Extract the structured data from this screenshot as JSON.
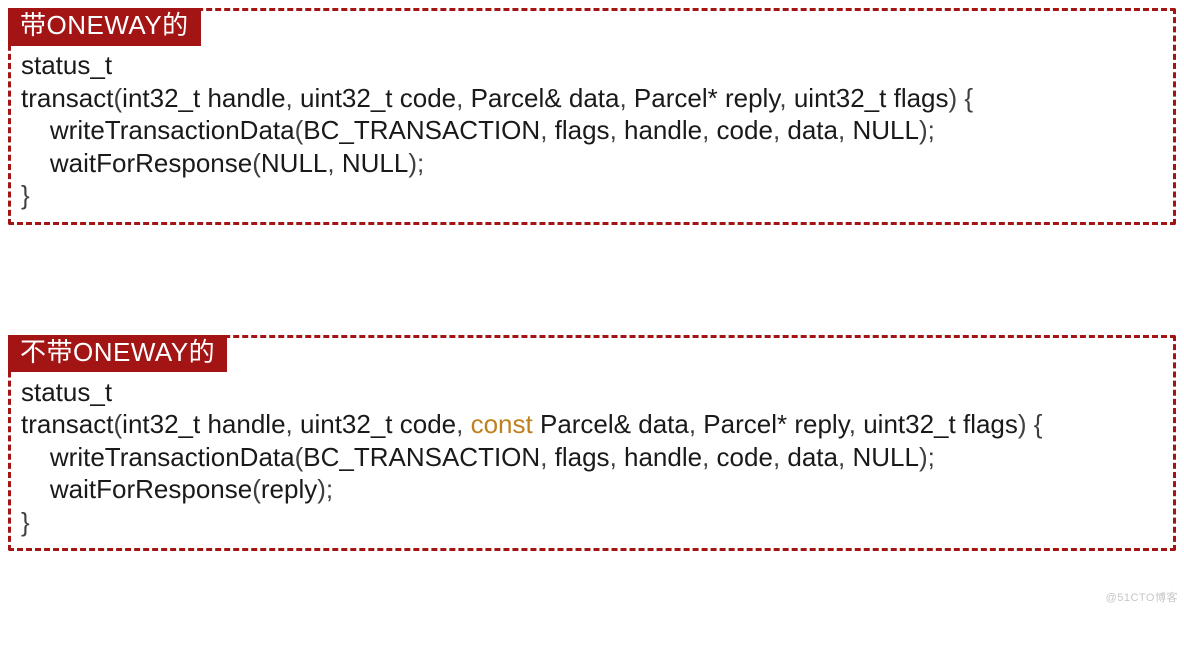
{
  "blocks": [
    {
      "title": "带ONEWAY的",
      "lines": [
        [
          {
            "t": "status_t",
            "c": "tok-id"
          }
        ],
        [
          {
            "t": "transact",
            "c": "tok-id"
          },
          {
            "t": "(",
            "c": "tok-punc"
          },
          {
            "t": "int32_t handle",
            "c": "tok-id"
          },
          {
            "t": ", ",
            "c": "tok-punc"
          },
          {
            "t": "uint32_t code",
            "c": "tok-id"
          },
          {
            "t": ", ",
            "c": "tok-punc"
          },
          {
            "t": "Parcel& data",
            "c": "tok-id"
          },
          {
            "t": ", ",
            "c": "tok-punc"
          },
          {
            "t": "Parcel* reply",
            "c": "tok-id"
          },
          {
            "t": ", ",
            "c": "tok-punc"
          },
          {
            "t": "uint32_t flags",
            "c": "tok-id"
          },
          {
            "t": ") {",
            "c": "tok-punc"
          }
        ],
        [
          {
            "t": "    writeTransactionData",
            "c": "tok-id"
          },
          {
            "t": "(",
            "c": "tok-punc"
          },
          {
            "t": "BC_TRANSACTION",
            "c": "tok-macro"
          },
          {
            "t": ", ",
            "c": "tok-punc"
          },
          {
            "t": "flags",
            "c": "tok-id"
          },
          {
            "t": ", ",
            "c": "tok-punc"
          },
          {
            "t": "handle",
            "c": "tok-id"
          },
          {
            "t": ", ",
            "c": "tok-punc"
          },
          {
            "t": "code",
            "c": "tok-id"
          },
          {
            "t": ", ",
            "c": "tok-punc"
          },
          {
            "t": "data",
            "c": "tok-id"
          },
          {
            "t": ", ",
            "c": "tok-punc"
          },
          {
            "t": "NULL",
            "c": "tok-id"
          },
          {
            "t": ");",
            "c": "tok-punc"
          }
        ],
        [
          {
            "t": "    waitForResponse",
            "c": "tok-id"
          },
          {
            "t": "(",
            "c": "tok-punc"
          },
          {
            "t": "NULL",
            "c": "tok-id"
          },
          {
            "t": ", ",
            "c": "tok-punc"
          },
          {
            "t": "NULL",
            "c": "tok-id"
          },
          {
            "t": ");",
            "c": "tok-punc"
          }
        ],
        [
          {
            "t": "}",
            "c": "tok-punc"
          }
        ]
      ]
    },
    {
      "title": "不带ONEWAY的",
      "lines": [
        [
          {
            "t": "status_t",
            "c": "tok-id"
          }
        ],
        [
          {
            "t": "transact",
            "c": "tok-id"
          },
          {
            "t": "(",
            "c": "tok-punc"
          },
          {
            "t": "int32_t handle",
            "c": "tok-id"
          },
          {
            "t": ", ",
            "c": "tok-punc"
          },
          {
            "t": "uint32_t code",
            "c": "tok-id"
          },
          {
            "t": ", ",
            "c": "tok-punc"
          },
          {
            "t": "const",
            "c": "tok-kw"
          },
          {
            "t": " Parcel& data",
            "c": "tok-id"
          },
          {
            "t": ", ",
            "c": "tok-punc"
          },
          {
            "t": "Parcel* reply",
            "c": "tok-id"
          },
          {
            "t": ", ",
            "c": "tok-punc"
          },
          {
            "t": "uint32_t flags",
            "c": "tok-id"
          },
          {
            "t": ") {",
            "c": "tok-punc"
          }
        ],
        [
          {
            "t": "    writeTransactionData",
            "c": "tok-id"
          },
          {
            "t": "(",
            "c": "tok-punc"
          },
          {
            "t": "BC_TRANSACTION",
            "c": "tok-macro"
          },
          {
            "t": ", ",
            "c": "tok-punc"
          },
          {
            "t": "flags",
            "c": "tok-id"
          },
          {
            "t": ", ",
            "c": "tok-punc"
          },
          {
            "t": "handle",
            "c": "tok-id"
          },
          {
            "t": ", ",
            "c": "tok-punc"
          },
          {
            "t": "code",
            "c": "tok-id"
          },
          {
            "t": ", ",
            "c": "tok-punc"
          },
          {
            "t": "data",
            "c": "tok-id"
          },
          {
            "t": ", ",
            "c": "tok-punc"
          },
          {
            "t": "NULL",
            "c": "tok-id"
          },
          {
            "t": ");",
            "c": "tok-punc"
          }
        ],
        [
          {
            "t": "    waitForResponse",
            "c": "tok-id"
          },
          {
            "t": "(",
            "c": "tok-punc"
          },
          {
            "t": "reply",
            "c": "tok-id"
          },
          {
            "t": ");",
            "c": "tok-punc"
          }
        ],
        [
          {
            "t": "}",
            "c": "tok-punc"
          }
        ]
      ]
    }
  ],
  "watermark": "@51CTO博客"
}
